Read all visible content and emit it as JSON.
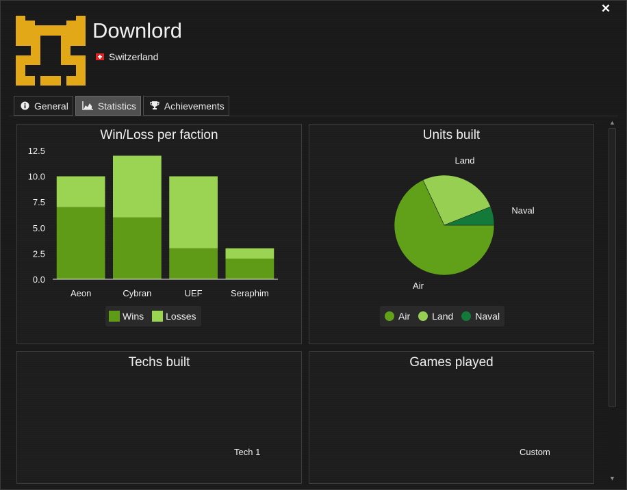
{
  "window": {
    "close_label": "✕"
  },
  "player": {
    "name": "Downlord",
    "country": "Switzerland"
  },
  "tabs": [
    {
      "label": "General",
      "icon": "info-icon"
    },
    {
      "label": "Statistics",
      "icon": "area-chart-icon",
      "active": true
    },
    {
      "label": "Achievements",
      "icon": "trophy-icon"
    }
  ],
  "panels": {
    "winloss_title": "Win/Loss per faction",
    "units_title": "Units built",
    "techs_title": "Techs built",
    "games_title": "Games played",
    "techs_label": "Tech 1",
    "games_label": "Custom"
  },
  "chart_data": [
    {
      "type": "bar",
      "stacked": true,
      "title": "Win/Loss per faction",
      "categories": [
        "Aeon",
        "Cybran",
        "UEF",
        "Seraphim"
      ],
      "series": [
        {
          "name": "Wins",
          "values": [
            7,
            6,
            3,
            2
          ],
          "color": "#5f9b16"
        },
        {
          "name": "Losses",
          "values": [
            3,
            6,
            7,
            1
          ],
          "color": "#9bd452"
        }
      ],
      "yticks": [
        "0.0",
        "2.5",
        "5.0",
        "7.5",
        "10.0",
        "12.5"
      ],
      "ylim": [
        0,
        12.5
      ],
      "grid": false,
      "legend": "bottom"
    },
    {
      "type": "pie",
      "title": "Units built",
      "slices": [
        {
          "name": "Air",
          "value": 68,
          "color": "#61a019"
        },
        {
          "name": "Land",
          "value": 26,
          "color": "#96cf52"
        },
        {
          "name": "Naval",
          "value": 6,
          "color": "#137a3a"
        }
      ],
      "legend": "bottom"
    }
  ]
}
